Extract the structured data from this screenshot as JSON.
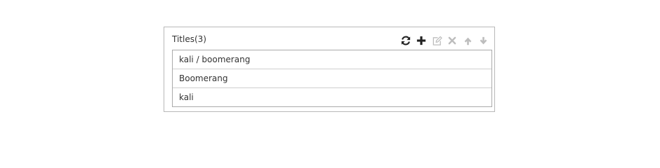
{
  "panel": {
    "title": "Titles",
    "count": "(3)"
  },
  "toolbar": {
    "icons": [
      "refresh-icon",
      "plus-icon",
      "edit-icon",
      "close-icon",
      "arrow-up-icon",
      "arrow-down-icon"
    ],
    "active_color": "#222222",
    "disabled_color": "#bdbdbd"
  },
  "titles": [
    {
      "label": "kali / boomerang"
    },
    {
      "label": "Boomerang"
    },
    {
      "label": "kali"
    }
  ]
}
